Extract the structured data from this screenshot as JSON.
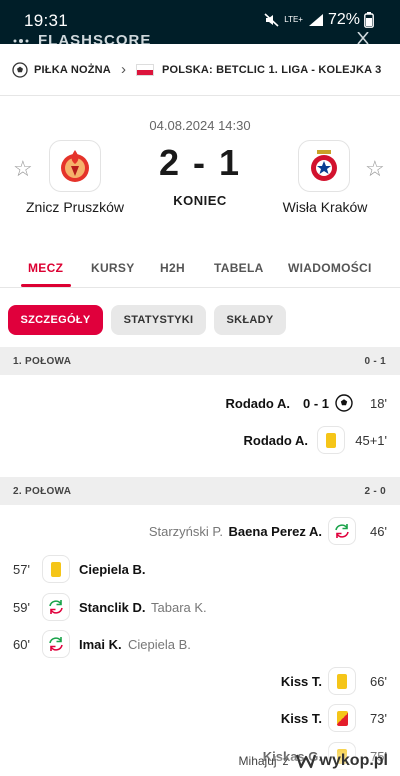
{
  "status_bar": {
    "time": "19:31",
    "network": "LTE+",
    "battery": "72%",
    "app_title_partial": "FLASHSCORE"
  },
  "breadcrumb": {
    "sport": "PIŁKA NOŻNA",
    "competition": "POLSKA: BETCLIC 1. LIGA - KOLEJKA 3"
  },
  "match": {
    "datetime": "04.08.2024 14:30",
    "home_team": "Znicz Pruszków",
    "away_team": "Wisła Kraków",
    "score": "2 - 1",
    "status": "KONIEC"
  },
  "tabs": [
    "MECZ",
    "KURSY",
    "H2H",
    "TABELA",
    "WIADOMOŚCI"
  ],
  "subtabs": [
    "SZCZEGÓŁY",
    "STATYSTYKI",
    "SKŁADY"
  ],
  "sections": [
    {
      "title": "1. POŁOWA",
      "score": "0 - 1",
      "events": [
        {
          "side": "away",
          "type": "goal",
          "player": "Rodado A.",
          "score": "0 - 1",
          "minute": "18'"
        },
        {
          "side": "away",
          "type": "yellow",
          "player": "Rodado A.",
          "minute": "45+1'"
        }
      ]
    },
    {
      "title": "2. POŁOWA",
      "score": "2 - 0",
      "events": [
        {
          "side": "away",
          "type": "sub",
          "player": "Baena Perez A.",
          "assist": "Starzyński P.",
          "minute": "46'"
        },
        {
          "side": "home",
          "type": "yellow",
          "player": "Ciepiela B.",
          "minute": "57'"
        },
        {
          "side": "home",
          "type": "sub",
          "player": "Stanclik D.",
          "assist": "Tabara K.",
          "minute": "59'"
        },
        {
          "side": "home",
          "type": "sub",
          "player": "Imai K.",
          "assist": "Ciepiela B.",
          "minute": "60'"
        },
        {
          "side": "away",
          "type": "yellow",
          "player": "Kiss T.",
          "minute": "66'"
        },
        {
          "side": "away",
          "type": "yellowred",
          "player": "Kiss T.",
          "minute": "73'"
        },
        {
          "side": "away",
          "type": "yellow",
          "player": "Kiskas G.",
          "minute": "75'"
        }
      ]
    }
  ],
  "watermark": {
    "user": "Mihajuj",
    "suffix": "z",
    "site": "wykop.pl"
  },
  "colors": {
    "accent": "#dc0032",
    "status_bar": "#001e28",
    "yellow_card": "#f5c518",
    "red_card": "#e41e2b",
    "sub_green": "#1aa34a",
    "sub_red": "#e0003c"
  }
}
